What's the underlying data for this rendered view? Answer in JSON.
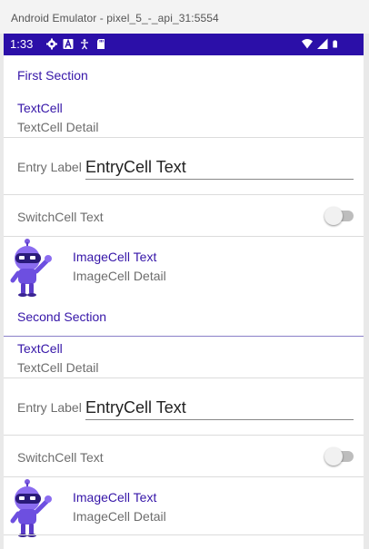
{
  "window": {
    "title": "Android Emulator - pixel_5_-_api_31:5554"
  },
  "status_bar": {
    "time": "1:33",
    "left_icons": [
      "gear-icon",
      "font-icon",
      "accessibility-icon",
      "sd-card-icon"
    ],
    "right_icons": [
      "wifi-icon",
      "cellular-signal-icon",
      "battery-icon"
    ],
    "color": "#2b0fa8"
  },
  "sections": [
    {
      "header": "First Section",
      "text_cell": {
        "text": "TextCell",
        "detail": "TextCell Detail"
      },
      "entry_cell": {
        "label": "Entry Label",
        "text": "EntryCell Text"
      },
      "switch_cell": {
        "text": "SwitchCell Text",
        "on": false
      },
      "image_cell": {
        "text": "ImageCell Text",
        "detail": "ImageCell Detail",
        "icon": "dotnet-bot-icon"
      }
    },
    {
      "header": "Second Section",
      "text_cell": {
        "text": "TextCell",
        "detail": "TextCell Detail"
      },
      "entry_cell": {
        "label": "Entry Label",
        "text": "EntryCell Text"
      },
      "switch_cell": {
        "text": "SwitchCell Text",
        "on": false
      },
      "image_cell": {
        "text": "ImageCell Text",
        "detail": "ImageCell Detail",
        "icon": "dotnet-bot-icon"
      }
    }
  ],
  "colors": {
    "accent": "#3616a8",
    "detail": "#6d6d6d"
  }
}
